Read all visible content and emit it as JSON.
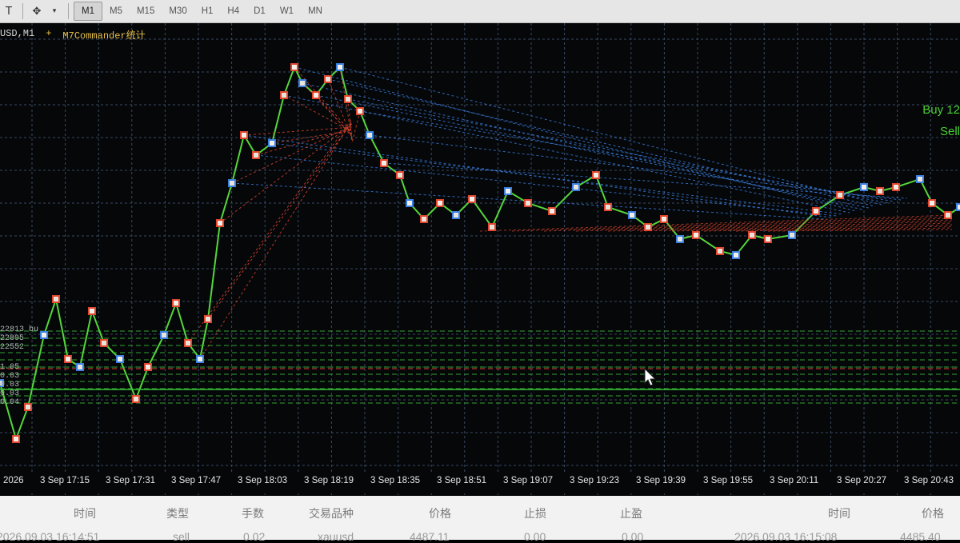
{
  "toolbar": {
    "icons": [
      "chart-type-icon",
      "drawing-tools-icon"
    ],
    "timeframes": [
      "M1",
      "M5",
      "M15",
      "M30",
      "H1",
      "H4",
      "D1",
      "W1",
      "MN"
    ],
    "active_timeframe": "M1"
  },
  "chart": {
    "symbol_label": "USD,M1",
    "plus": "+",
    "indicator_label": "M7Commander统计",
    "buy_label": "Buy 12",
    "sell_label": "Sell",
    "lot_labels": [
      "22813 bu",
      "22805",
      "22552",
      "1.05",
      "0.03",
      "0.03",
      "0.03",
      "0.04"
    ],
    "colors": {
      "background": "#050709",
      "grid": "#3a4a63",
      "buy_line": "#3a7fe0",
      "sell_line": "#e0462e",
      "price": "#55d63a"
    }
  },
  "time_axis": [
    "2026",
    "3 Sep 17:15",
    "3 Sep 17:31",
    "3 Sep 17:47",
    "3 Sep 18:03",
    "3 Sep 18:19",
    "3 Sep 18:35",
    "3 Sep 18:51",
    "3 Sep 19:07",
    "3 Sep 19:23",
    "3 Sep 19:39",
    "3 Sep 19:55",
    "3 Sep 20:11",
    "3 Sep 20:27",
    "3 Sep 20:43"
  ],
  "table": {
    "headers": [
      "时间",
      "类型",
      "手数",
      "交易品种",
      "价格",
      "止损",
      "止盈",
      "时间",
      "价格"
    ],
    "row": [
      "2026.09.03 16:14:51",
      "sell",
      "0.02",
      "xauusd",
      "4487.11",
      "0.00",
      "0.00",
      "2026.09.03 16:15:08",
      "4485.40"
    ]
  }
}
